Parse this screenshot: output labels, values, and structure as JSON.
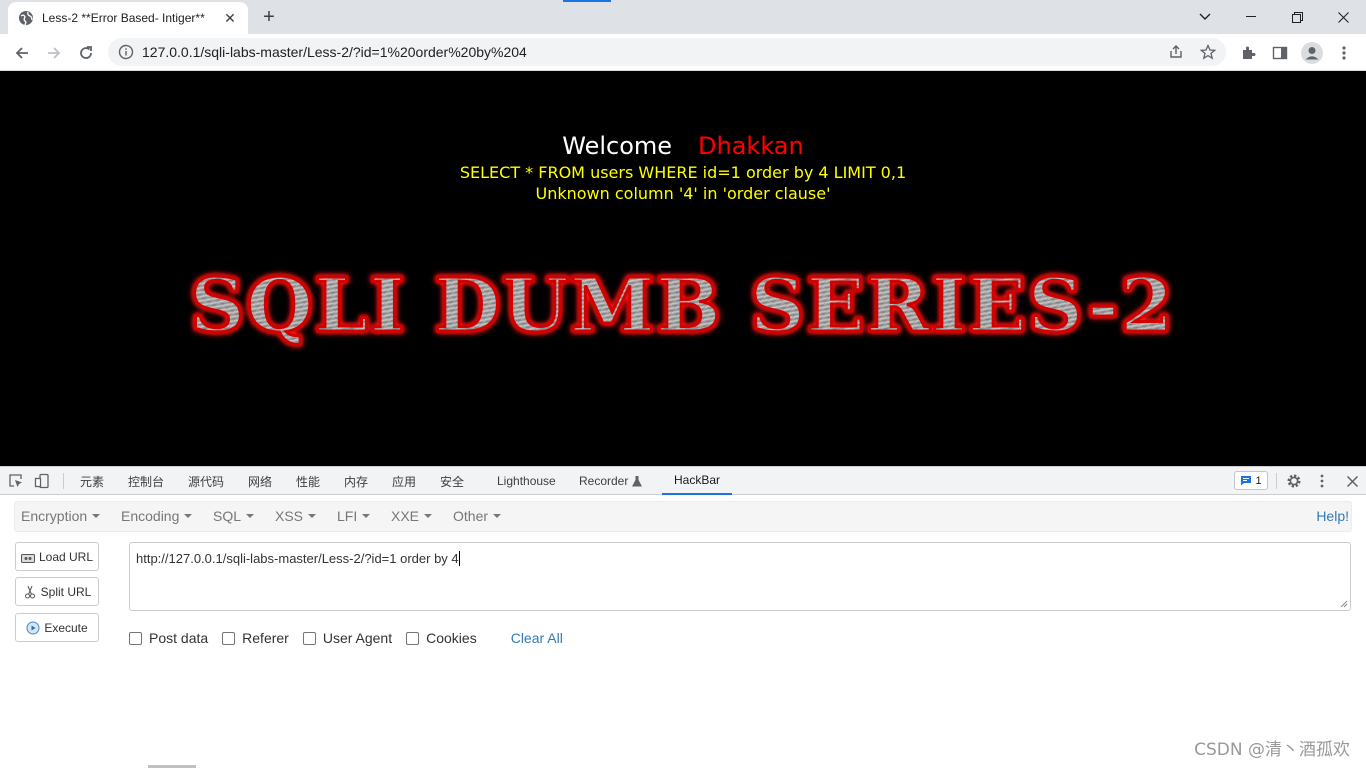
{
  "browser": {
    "tab_title": "Less-2 **Error Based- Intiger**",
    "url": "127.0.0.1/sqli-labs-master/Less-2/?id=1%20order%20by%204"
  },
  "page": {
    "welcome": "Welcome",
    "name": "Dhakkan",
    "query": "SELECT * FROM users WHERE id=1 order by 4 LIMIT 0,1",
    "error": "Unknown column '4' in 'order clause'",
    "banner": "SQLI DUMB SERIES-2"
  },
  "devtools": {
    "tabs": [
      "元素",
      "控制台",
      "源代码",
      "网络",
      "性能",
      "内存",
      "应用",
      "安全",
      "Lighthouse",
      "Recorder",
      "HackBar"
    ],
    "active_tab": "HackBar",
    "issues_count": "1"
  },
  "hackbar": {
    "menu": [
      "Encryption",
      "Encoding",
      "SQL",
      "XSS",
      "LFI",
      "XXE",
      "Other"
    ],
    "help": "Help!",
    "buttons": {
      "load": "Load URL",
      "split": "Split URL",
      "execute": "Execute"
    },
    "url_value": "http://127.0.0.1/sqli-labs-master/Less-2/?id=1 order by 4",
    "options": [
      "Post data",
      "Referer",
      "User Agent",
      "Cookies"
    ],
    "clear_all": "Clear All"
  },
  "watermark": "CSDN @清丶酒孤欢",
  "colors": {
    "accent": "#1a73e8",
    "welcome_name": "#ff0000",
    "query_text": "#ffff00",
    "hackbar_link": "#337ab7"
  }
}
